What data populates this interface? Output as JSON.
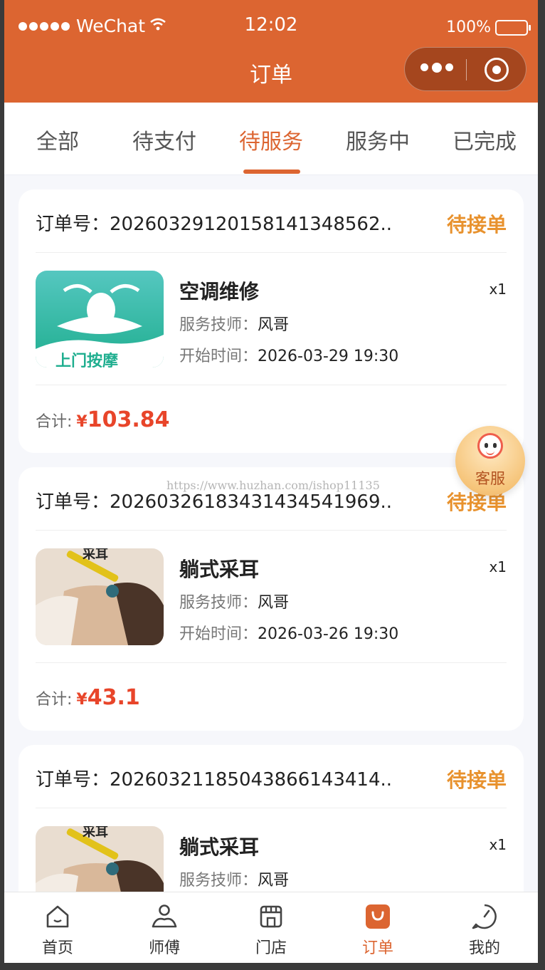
{
  "status_bar": {
    "carrier": "WeChat",
    "time": "12:02",
    "battery": "100%"
  },
  "nav": {
    "title": "订单"
  },
  "tabs": [
    {
      "label": "全部"
    },
    {
      "label": "待支付"
    },
    {
      "label": "待服务"
    },
    {
      "label": "服务中"
    },
    {
      "label": "已完成"
    }
  ],
  "active_tab": "待服务",
  "order_labels": {
    "order_no": "订单号：",
    "technician": "服务技师：",
    "start_time": "开始时间：",
    "total": "合计:",
    "currency": "¥"
  },
  "orders": [
    {
      "order_no": "20260329120158141348562...",
      "status": "待接单",
      "service": "空调维修",
      "qty": "x1",
      "technician": "风哥",
      "start_time": "2026-03-29 19:30",
      "total": "103.84",
      "thumb_text": "上门按摩"
    },
    {
      "order_no": "20260326183431434541969...",
      "status": "待接单",
      "service": "躺式采耳",
      "qty": "x1",
      "technician": "风哥",
      "start_time": "2026-03-26 19:30",
      "total": "43.1",
      "thumb_text": "采耳"
    },
    {
      "order_no": "20260321185043866143414...",
      "status": "待接单",
      "service": "躺式采耳",
      "qty": "x1",
      "technician": "风哥",
      "thumb_text": "采耳"
    }
  ],
  "watermark": "https://www.huzhan.com/ishop11135",
  "float_service": {
    "label": "客服"
  },
  "tabbar": [
    {
      "label": "首页",
      "icon": "home-icon"
    },
    {
      "label": "师傅",
      "icon": "master-icon"
    },
    {
      "label": "门店",
      "icon": "store-icon"
    },
    {
      "label": "订单",
      "icon": "order-bag-icon"
    },
    {
      "label": "我的",
      "icon": "profile-icon"
    }
  ],
  "colors": {
    "brand": "#dc6531",
    "status": "#e8922e",
    "price": "#e8452a"
  }
}
